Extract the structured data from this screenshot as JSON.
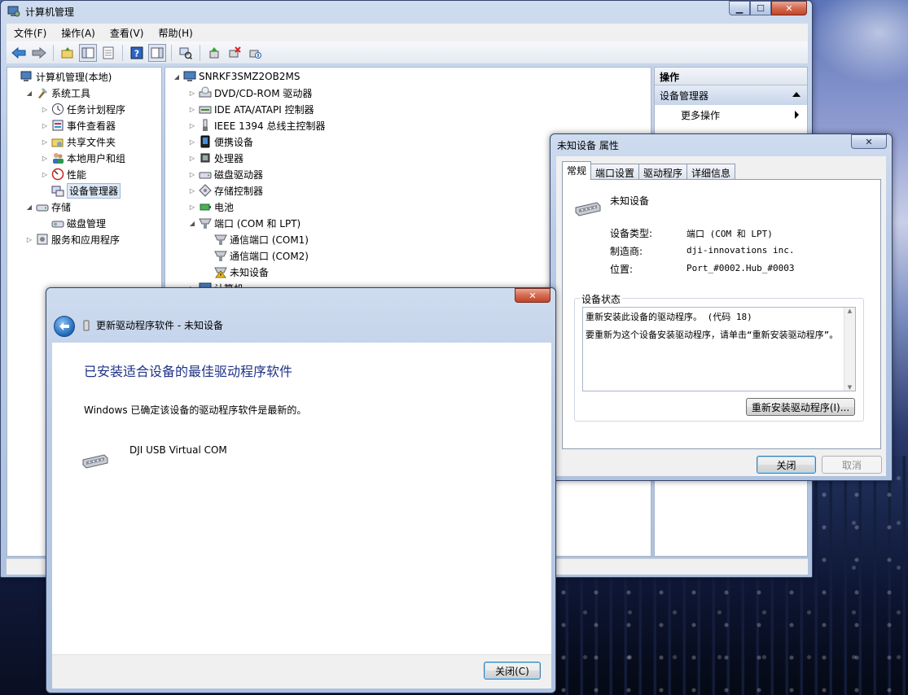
{
  "computer_management": {
    "title": "计算机管理",
    "menu": [
      "文件(F)",
      "操作(A)",
      "查看(V)",
      "帮助(H)"
    ],
    "left_tree": [
      {
        "label": "计算机管理(本地)",
        "level": 0,
        "expander": "",
        "icon": "computer-management-icon"
      },
      {
        "label": "系统工具",
        "level": 1,
        "expander": "◢",
        "icon": "system-tools-icon"
      },
      {
        "label": "任务计划程序",
        "level": 2,
        "expander": "▷",
        "icon": "task-scheduler-icon"
      },
      {
        "label": "事件查看器",
        "level": 2,
        "expander": "▷",
        "icon": "event-viewer-icon"
      },
      {
        "label": "共享文件夹",
        "level": 2,
        "expander": "▷",
        "icon": "shared-folders-icon"
      },
      {
        "label": "本地用户和组",
        "level": 2,
        "expander": "▷",
        "icon": "users-icon"
      },
      {
        "label": "性能",
        "level": 2,
        "expander": "▷",
        "icon": "performance-icon"
      },
      {
        "label": "设备管理器",
        "level": 2,
        "expander": "",
        "icon": "device-manager-icon",
        "selected": true
      },
      {
        "label": "存储",
        "level": 1,
        "expander": "◢",
        "icon": "storage-icon"
      },
      {
        "label": "磁盘管理",
        "level": 2,
        "expander": "",
        "icon": "disk-management-icon"
      },
      {
        "label": "服务和应用程序",
        "level": 1,
        "expander": "▷",
        "icon": "services-icon"
      }
    ],
    "device_tree": [
      {
        "label": "SNRKF3SMZ2OB2MS",
        "level": 0,
        "expander": "◢",
        "icon": "computer-icon"
      },
      {
        "label": "DVD/CD-ROM 驱动器",
        "level": 1,
        "expander": "▷",
        "icon": "dvd-icon"
      },
      {
        "label": "IDE ATA/ATAPI 控制器",
        "level": 1,
        "expander": "▷",
        "icon": "ide-icon"
      },
      {
        "label": "IEEE 1394 总线主控制器",
        "level": 1,
        "expander": "▷",
        "icon": "ieee1394-icon"
      },
      {
        "label": "便携设备",
        "level": 1,
        "expander": "▷",
        "icon": "portable-device-icon"
      },
      {
        "label": "处理器",
        "level": 1,
        "expander": "▷",
        "icon": "processor-icon"
      },
      {
        "label": "磁盘驱动器",
        "level": 1,
        "expander": "▷",
        "icon": "disk-drive-icon"
      },
      {
        "label": "存储控制器",
        "level": 1,
        "expander": "▷",
        "icon": "storage-controller-icon"
      },
      {
        "label": "电池",
        "level": 1,
        "expander": "▷",
        "icon": "battery-icon"
      },
      {
        "label": "端口 (COM 和 LPT)",
        "level": 1,
        "expander": "◢",
        "icon": "port-icon"
      },
      {
        "label": "通信端口 (COM1)",
        "level": 2,
        "expander": "",
        "icon": "port-icon"
      },
      {
        "label": "通信端口 (COM2)",
        "level": 2,
        "expander": "",
        "icon": "port-icon"
      },
      {
        "label": "未知设备",
        "level": 2,
        "expander": "",
        "icon": "warning-port-icon"
      },
      {
        "label": "计算机",
        "level": 1,
        "expander": "▷",
        "icon": "computer-icon"
      }
    ],
    "operations": {
      "header": "操作",
      "section": "设备管理器",
      "more": "更多操作"
    }
  },
  "properties_dialog": {
    "title": "未知设备 属性",
    "tabs": [
      "常规",
      "端口设置",
      "驱动程序",
      "详细信息"
    ],
    "device_name": "未知设备",
    "fields": [
      {
        "label": "设备类型:",
        "value": "端口 (COM 和 LPT)"
      },
      {
        "label": "制造商:",
        "value": "dji-innovations inc."
      },
      {
        "label": "位置:",
        "value": "Port_#0002.Hub_#0003"
      }
    ],
    "status_group_title": "设备状态",
    "status_line1": "重新安装此设备的驱动程序。 (代码 18)",
    "status_line2": "要重新为这个设备安装驱动程序，请单击“重新安装驱动程序”。",
    "reinstall_button": "重新安装驱动程序(I)...",
    "close_button": "关闭",
    "cancel_button": "取消"
  },
  "update_wizard": {
    "title": "更新驱动程序软件 - 未知设备",
    "heading": "已安装适合设备的最佳驱动程序软件",
    "message": "Windows 已确定该设备的驱动程序软件是最新的。",
    "device": "DJI USB Virtual COM",
    "close_button": "关闭(C)"
  },
  "colors": {
    "heading_blue": "#1e3287",
    "selection": "#dde8f5",
    "warning": "#f0c020"
  }
}
